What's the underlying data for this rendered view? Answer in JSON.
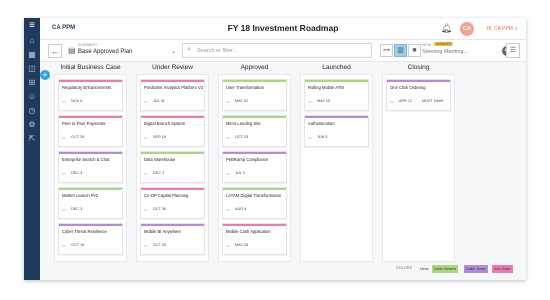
{
  "app": {
    "brand": "CA PPM",
    "title": "FY 18 Investment Roadmap"
  },
  "user": {
    "initials": "CA",
    "label": "Hi, CA PPM ∨"
  },
  "toolbar": {
    "scenario_label": "SCENARIO",
    "scenario_value": "Base Approved Plan",
    "search_placeholder": "Search or filter...",
    "view_label": "VIEW",
    "view_badge": "UNSAVED",
    "view_value": "Steering Meeting..."
  },
  "columns": [
    {
      "title": "Initial Business Case",
      "cards": [
        {
          "title": "Regulatory Enhancements",
          "date": "NOV 6",
          "color": "pink"
        },
        {
          "title": "Peer to Peer Payments",
          "date": "OCT 29",
          "color": "pink"
        },
        {
          "title": "Enterprise Search & Chat",
          "date": "DEC 3",
          "color": "purple"
        },
        {
          "title": "Market Launch Pv2",
          "date": "DEC 3",
          "color": "green"
        },
        {
          "title": "Cyber Threat Resilience",
          "date": "OCT 15",
          "color": "purple"
        }
      ]
    },
    {
      "title": "Under Review",
      "cards": [
        {
          "title": "Predictive Analytics Platform V2",
          "date": "JUL 31",
          "color": "pink"
        },
        {
          "title": "Digital Branch System",
          "date": "SEP 18",
          "color": "pink"
        },
        {
          "title": "Data Warehouse",
          "date": "DEC 3",
          "color": "green"
        },
        {
          "title": "Co-OP Capital Planning",
          "date": "OCT 30",
          "color": "pink"
        },
        {
          "title": "Mobile BI Anywhere",
          "date": "OCT 26",
          "color": "purple"
        }
      ]
    },
    {
      "title": "Approved",
      "cards": [
        {
          "title": "User Transformation",
          "date": "MAY 31",
          "color": "green"
        },
        {
          "title": "Micro Lending Site",
          "date": "OCT 23",
          "color": "green"
        },
        {
          "title": "PeBRamp Compliance",
          "date": "JUL 9",
          "color": "purple"
        },
        {
          "title": "LATAM Digital Transformation",
          "date": "AUG 6",
          "color": "green"
        },
        {
          "title": "Mobile Cash Application",
          "date": "MAY 28",
          "color": "pink"
        }
      ]
    },
    {
      "title": "Launched",
      "cards": [
        {
          "title": "Rolling Mobile ATM",
          "date": "MAY 15",
          "color": "green"
        },
        {
          "title": "Authentication",
          "date": "JUN 5",
          "color": "purple"
        }
      ]
    },
    {
      "title": "Closing",
      "cards": [
        {
          "title": "One Click Ordering",
          "date": "APR 12",
          "extra": "MUST HAVE",
          "color": "purple"
        }
      ]
    }
  ],
  "legend": {
    "label": "COLORS",
    "items": [
      {
        "name": "None",
        "color": "none"
      },
      {
        "name": "Dario Yamera",
        "color": "green"
      },
      {
        "name": "Callie Jones",
        "color": "purple"
      },
      {
        "name": "Eric Gulse",
        "color": "pink"
      }
    ]
  },
  "palette": {
    "green": "#a9d67f",
    "purple": "#b38bd8",
    "pink": "#ef7ab0",
    "none": "#ffffff",
    "accent": "#2aa3e0",
    "rail": "#1f3a5a"
  }
}
